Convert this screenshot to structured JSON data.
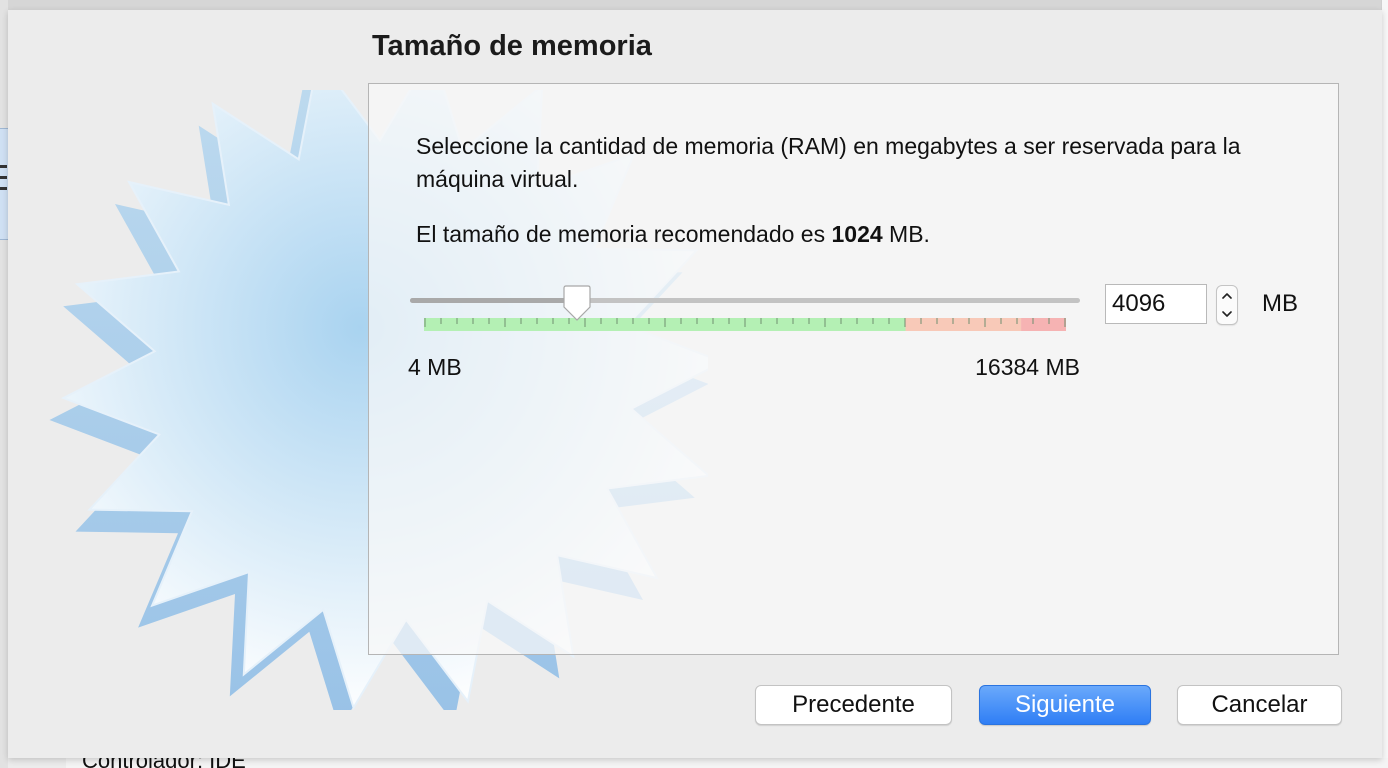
{
  "background": {
    "partial_label": "Controlador: IDE"
  },
  "dialog": {
    "title": "Tamaño de memoria",
    "description": "Seleccione la cantidad de memoria (RAM) en megabytes a ser reservada para la máquina virtual.",
    "recommend_prefix": "El tamaño de memoria recomendado es ",
    "recommend_value": "1024",
    "recommend_suffix": " MB."
  },
  "memory": {
    "value": "4096",
    "unit": "MB",
    "min_label": "4 MB",
    "max_label": "16384 MB",
    "min_mb": 4,
    "max_mb": 16384,
    "current_mb": 4096,
    "zones": {
      "safe_color": "#b4f0b4",
      "warn_color": "#f8c9b8",
      "danger_color": "#f6b3b3"
    }
  },
  "buttons": {
    "back": "Precedente",
    "next": "Siguiente",
    "cancel": "Cancelar"
  },
  "colors": {
    "accent": "#2f7ef5",
    "window_bg": "#ececec"
  },
  "icons": {
    "wizard_art": "virtualbox-starburst-icon",
    "step_up": "chevron-up-icon",
    "step_down": "chevron-down-icon"
  }
}
